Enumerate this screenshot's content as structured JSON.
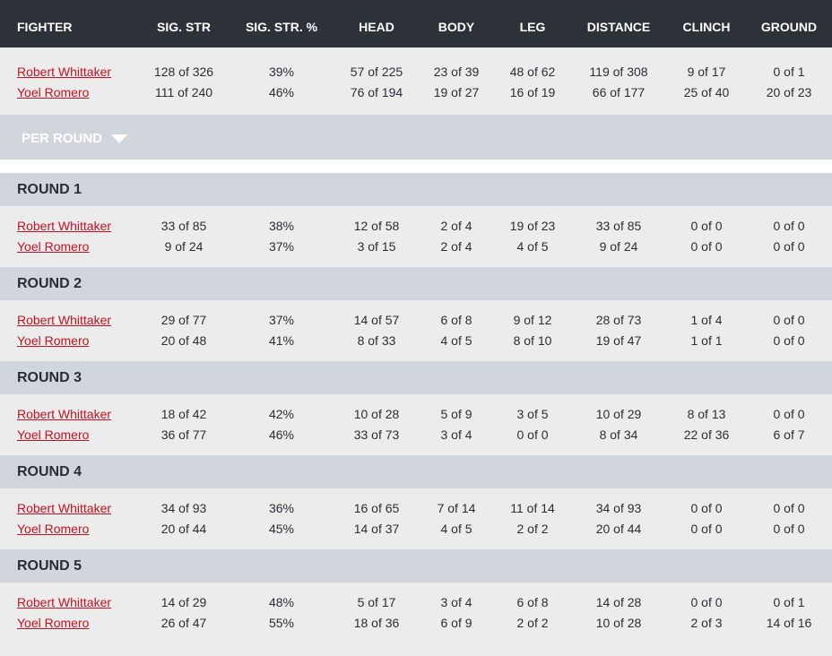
{
  "header": {
    "fighter": "FIGHTER",
    "sig_str": "SIG. STR",
    "sig_str_pct": "SIG. STR. %",
    "head": "HEAD",
    "body": "BODY",
    "leg": "LEG",
    "distance": "DISTANCE",
    "clinch": "CLINCH",
    "ground": "GROUND"
  },
  "totals": [
    {
      "name": "Robert Whittaker",
      "sig_str": "128 of 326",
      "pct": "39%",
      "head": "57 of 225",
      "body": "23 of 39",
      "leg": "48 of 62",
      "distance": "119 of 308",
      "clinch": "9 of 17",
      "ground": "0 of 1"
    },
    {
      "name": "Yoel Romero",
      "sig_str": "111 of 240",
      "pct": "46%",
      "head": "76 of 194",
      "body": "19 of 27",
      "leg": "16 of 19",
      "distance": "66 of 177",
      "clinch": "25 of 40",
      "ground": "20 of 23"
    }
  ],
  "per_round_label": "PER ROUND",
  "rounds": [
    {
      "title": "ROUND 1",
      "rows": [
        {
          "name": "Robert Whittaker",
          "sig_str": "33 of 85",
          "pct": "38%",
          "head": "12 of 58",
          "body": "2 of 4",
          "leg": "19 of 23",
          "distance": "33 of 85",
          "clinch": "0 of 0",
          "ground": "0 of 0"
        },
        {
          "name": "Yoel Romero",
          "sig_str": "9 of 24",
          "pct": "37%",
          "head": "3 of 15",
          "body": "2 of 4",
          "leg": "4 of 5",
          "distance": "9 of 24",
          "clinch": "0 of 0",
          "ground": "0 of 0"
        }
      ]
    },
    {
      "title": "ROUND 2",
      "rows": [
        {
          "name": "Robert Whittaker",
          "sig_str": "29 of 77",
          "pct": "37%",
          "head": "14 of 57",
          "body": "6 of 8",
          "leg": "9 of 12",
          "distance": "28 of 73",
          "clinch": "1 of 4",
          "ground": "0 of 0"
        },
        {
          "name": "Yoel Romero",
          "sig_str": "20 of 48",
          "pct": "41%",
          "head": "8 of 33",
          "body": "4 of 5",
          "leg": "8 of 10",
          "distance": "19 of 47",
          "clinch": "1 of 1",
          "ground": "0 of 0"
        }
      ]
    },
    {
      "title": "ROUND 3",
      "rows": [
        {
          "name": "Robert Whittaker",
          "sig_str": "18 of 42",
          "pct": "42%",
          "head": "10 of 28",
          "body": "5 of 9",
          "leg": "3 of 5",
          "distance": "10 of 29",
          "clinch": "8 of 13",
          "ground": "0 of 0"
        },
        {
          "name": "Yoel Romero",
          "sig_str": "36 of 77",
          "pct": "46%",
          "head": "33 of 73",
          "body": "3 of 4",
          "leg": "0 of 0",
          "distance": "8 of 34",
          "clinch": "22 of 36",
          "ground": "6 of 7"
        }
      ]
    },
    {
      "title": "ROUND 4",
      "rows": [
        {
          "name": "Robert Whittaker",
          "sig_str": "34 of 93",
          "pct": "36%",
          "head": "16 of 65",
          "body": "7 of 14",
          "leg": "11 of 14",
          "distance": "34 of 93",
          "clinch": "0 of 0",
          "ground": "0 of 0"
        },
        {
          "name": "Yoel Romero",
          "sig_str": "20 of 44",
          "pct": "45%",
          "head": "14 of 37",
          "body": "4 of 5",
          "leg": "2 of 2",
          "distance": "20 of 44",
          "clinch": "0 of 0",
          "ground": "0 of 0"
        }
      ]
    },
    {
      "title": "ROUND 5",
      "rows": [
        {
          "name": "Robert Whittaker",
          "sig_str": "14 of 29",
          "pct": "48%",
          "head": "5 of 17",
          "body": "3 of 4",
          "leg": "6 of 8",
          "distance": "14 of 28",
          "clinch": "0 of 0",
          "ground": "0 of 1"
        },
        {
          "name": "Yoel Romero",
          "sig_str": "26 of 47",
          "pct": "55%",
          "head": "18 of 36",
          "body": "6 of 9",
          "leg": "2 of 2",
          "distance": "10 of 28",
          "clinch": "2 of 3",
          "ground": "14 of 16"
        }
      ]
    }
  ]
}
